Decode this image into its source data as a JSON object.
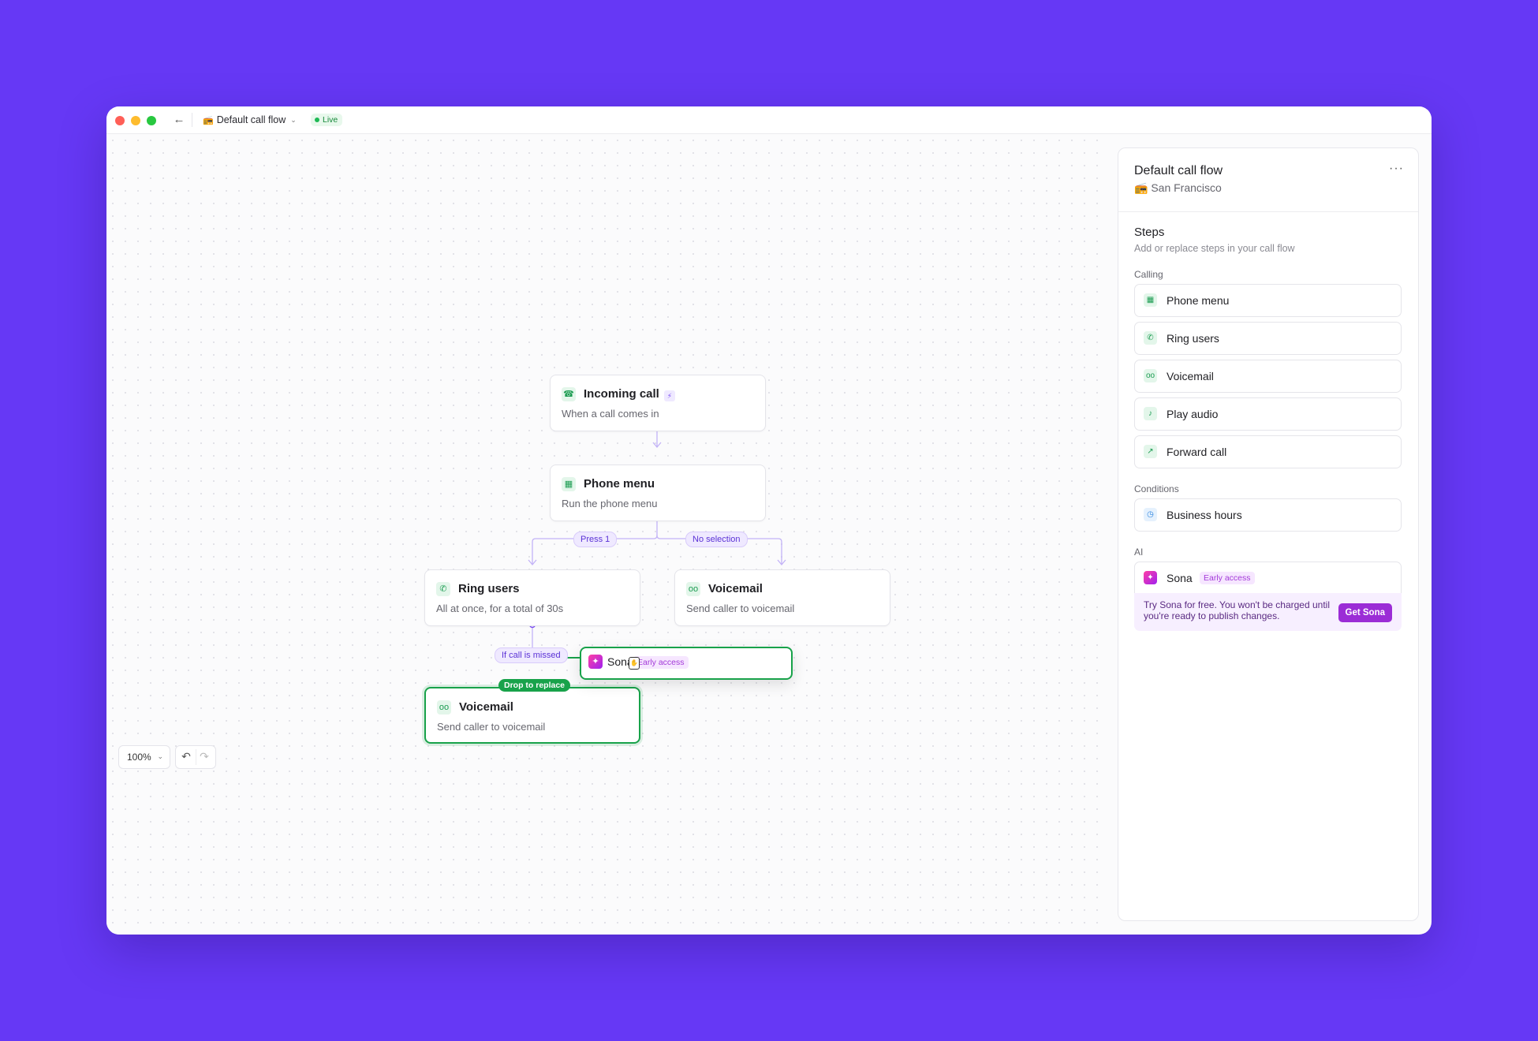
{
  "titlebar": {
    "flow_title": "Default call flow",
    "flow_emoji": "📻",
    "status": "Live",
    "back_icon": "arrow-left-icon"
  },
  "canvas": {
    "nodes": {
      "incoming": {
        "title": "Incoming call",
        "subtitle": "When a call comes in",
        "icon": "phone-incoming-icon"
      },
      "phone_menu": {
        "title": "Phone menu",
        "subtitle": "Run the phone menu",
        "icon": "keypad-icon"
      },
      "ring_users": {
        "title": "Ring users",
        "subtitle": "All at once, for a total of 30s",
        "icon": "phone-ringing-icon"
      },
      "voicemail_a": {
        "title": "Voicemail",
        "subtitle": "Send caller to voicemail",
        "icon": "voicemail-icon"
      },
      "voicemail_b": {
        "title": "Voicemail",
        "subtitle": "Send caller to voicemail",
        "icon": "voicemail-icon"
      }
    },
    "edge_labels": {
      "press_1": "Press 1",
      "no_selection": "No selection",
      "if_missed": "If call is missed"
    },
    "drop_label": "Drop to replace",
    "drag_card": {
      "title": "Sona",
      "badge": "Early access"
    },
    "zoom": "100%"
  },
  "panel": {
    "title": "Default call flow",
    "location_emoji": "📻",
    "location": "San Francisco",
    "steps_title": "Steps",
    "steps_subtitle": "Add or replace steps in your call flow",
    "groups": {
      "calling": "Calling",
      "conditions": "Conditions",
      "ai": "AI"
    },
    "calling_items": [
      "Phone menu",
      "Ring users",
      "Voicemail",
      "Play audio",
      "Forward call"
    ],
    "condition_items": [
      "Business hours"
    ],
    "ai_item": {
      "label": "Sona",
      "badge": "Early access"
    },
    "promo": {
      "text": "Try Sona for free. You won't be charged until you're ready to publish changes.",
      "button": "Get Sona"
    }
  },
  "colors": {
    "background": "#6638f5",
    "accent_green": "#18a24a",
    "accent_purple": "#7a4cf4",
    "sona_gradient": "#ff3fa4-#a020f0"
  }
}
